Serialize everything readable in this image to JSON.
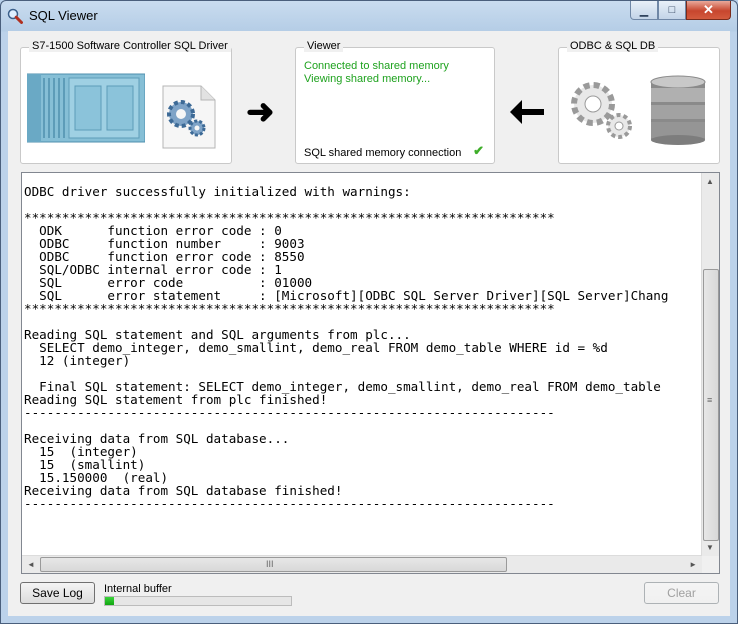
{
  "window": {
    "title": "SQL Viewer",
    "minimize_glyph": "▁",
    "maximize_glyph": "□",
    "close_glyph": "✕"
  },
  "panels": {
    "driver": {
      "label": "S7-1500 Software Controller SQL Driver"
    },
    "viewer": {
      "label": "Viewer",
      "status_lines": [
        "Connected to shared memory",
        "Viewing shared memory..."
      ],
      "connection_label": "SQL shared memory connection",
      "check_glyph": "✔"
    },
    "db": {
      "label": "ODBC & SQL DB"
    }
  },
  "arrows": {
    "left_glyph": "➜",
    "right_glyph": "🡠"
  },
  "log": {
    "lines": [
      "ODBC driver successfully initialized with warnings:",
      "",
      "**********************************************************************",
      "  ODK      function error code : 0",
      "  ODBC     function number     : 9003",
      "  ODBC     function error code : 8550",
      "  SQL/ODBC internal error code : 1",
      "  SQL      error code          : 01000",
      "  SQL      error statement     : [Microsoft][ODBC SQL Server Driver][SQL Server]Chang",
      "**********************************************************************",
      "",
      "Reading SQL statement and SQL arguments from plc...",
      "  SELECT demo_integer, demo_smallint, demo_real FROM demo_table WHERE id = %d",
      "  12 (integer)",
      "",
      "  Final SQL statement: SELECT demo_integer, demo_smallint, demo_real FROM demo_table",
      "Reading SQL statement from plc finished!",
      "----------------------------------------------------------------------",
      "",
      "Receiving data from SQL database...",
      "  15  (integer)",
      "  15  (smallint)",
      "  15.150000  (real)",
      "Receiving data from SQL database finished!",
      "----------------------------------------------------------------------"
    ]
  },
  "scroll": {
    "up": "▲",
    "down": "▼",
    "left": "◄",
    "right": "►",
    "grip_h": "III",
    "grip_v": "≡"
  },
  "footer": {
    "save_log_label": "Save Log",
    "buffer_label": "Internal buffer",
    "buffer_fill_fraction": 0.05,
    "clear_label": "Clear"
  },
  "colors": {
    "status_green": "#1ea21e",
    "progress_green": "#11a511"
  }
}
